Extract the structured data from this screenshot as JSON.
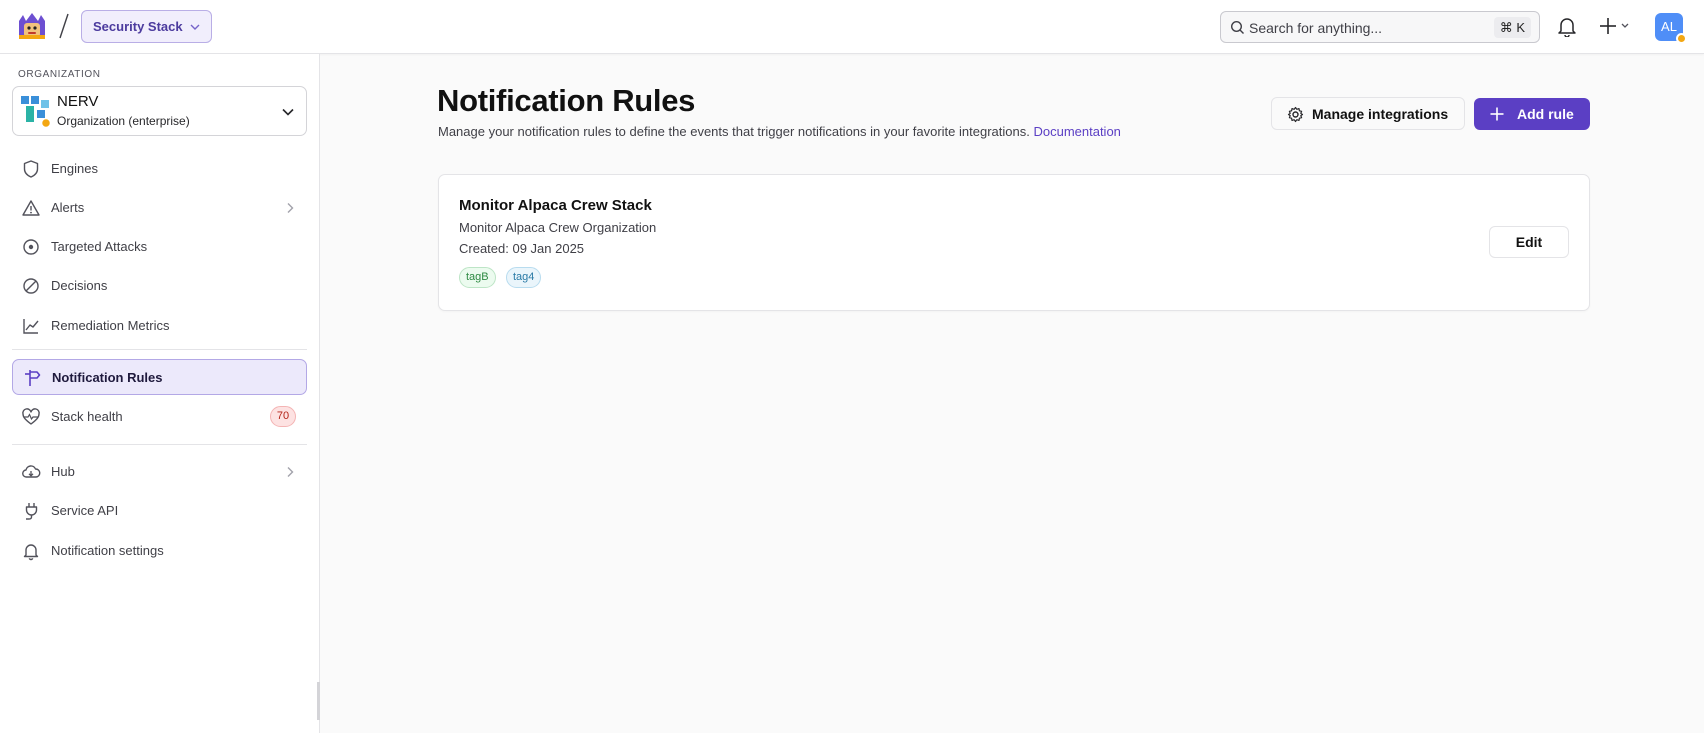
{
  "header": {
    "stack_selector": "Security Stack",
    "search_placeholder": "Search for anything...",
    "search_shortcut": "⌘ K",
    "user_initials": "AL"
  },
  "sidebar": {
    "org_label": "ORGANIZATION",
    "org_name": "NERV",
    "org_type": "Organization (enterprise)",
    "items": [
      {
        "label": "Engines",
        "icon": "shield-icon"
      },
      {
        "label": "Alerts",
        "icon": "warning-triangle-icon",
        "has_arrow": true
      },
      {
        "label": "Targeted Attacks",
        "icon": "target-icon"
      },
      {
        "label": "Decisions",
        "icon": "ban-icon"
      },
      {
        "label": "Remediation Metrics",
        "icon": "line-chart-icon"
      },
      {
        "label": "Notification Rules",
        "icon": "signpost-icon",
        "active": true
      },
      {
        "label": "Stack health",
        "icon": "heart-pulse-icon",
        "badge": "70"
      },
      {
        "label": "Hub",
        "icon": "cloud-download-icon",
        "has_arrow": true
      },
      {
        "label": "Service API",
        "icon": "plug-icon"
      },
      {
        "label": "Notification settings",
        "icon": "bell-icon"
      }
    ]
  },
  "main": {
    "title": "Notification Rules",
    "description": "Manage your notification rules to define the events that trigger notifications in your favorite integrations.",
    "doc_link": "Documentation",
    "manage_button": "Manage integrations",
    "add_button": "Add rule",
    "rules": [
      {
        "name": "Monitor Alpaca Crew Stack",
        "org": "Monitor Alpaca Crew Organization",
        "created": "Created: 09 Jan 2025",
        "tags": [
          "tagB",
          "tag4"
        ],
        "edit_label": "Edit"
      }
    ]
  },
  "colors": {
    "accent": "#5b3fc4",
    "active_bg": "#ece9fb",
    "avatar": "#4f8ef7",
    "badge_red": "#b42318"
  }
}
